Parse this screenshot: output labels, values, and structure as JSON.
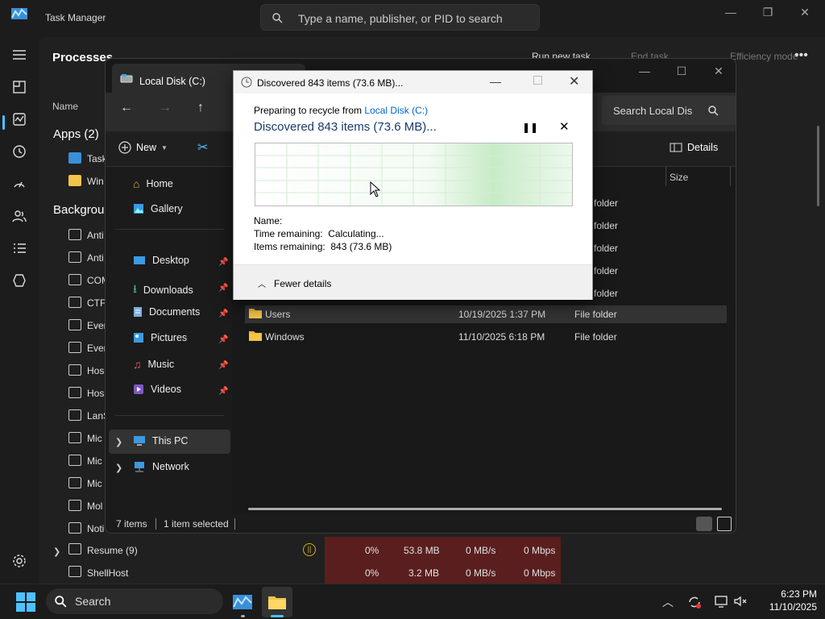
{
  "task_manager": {
    "title": "Task Manager",
    "search_placeholder": "Type a name, publisher, or PID to search",
    "section": "Processes",
    "run_new_task": "Run new task",
    "end_task": "End task",
    "efficiency_mode": "Efficiency mode",
    "col_name": "Name",
    "apps_header": "Apps (2)",
    "background_header": "Backgrou",
    "app_rows": [
      "Task",
      "Win"
    ],
    "bg_rows": [
      "Anti",
      "Anti",
      "COM",
      "CTF",
      "Ever",
      "Ever",
      "Hos",
      "Hos",
      "LanS",
      "Mic",
      "Mic",
      "Mic",
      "Mol",
      "Noti"
    ],
    "resume_row": {
      "name": "Resume (9)",
      "cpu": "0%",
      "mem": "53.8 MB",
      "disk": "0 MB/s",
      "net": "0 Mbps"
    },
    "shellhost_row": {
      "name": "ShellHost",
      "cpu": "0%",
      "mem": "3.2 MB",
      "disk": "0 MB/s",
      "net": "0 Mbps"
    }
  },
  "explorer": {
    "tab_title": "Local Disk (C:)",
    "search_placeholder": "Search Local Dis",
    "new_label": "New",
    "details_label": "Details",
    "col_size": "Size",
    "nav": {
      "home": "Home",
      "gallery": "Gallery",
      "desktop": "Desktop",
      "downloads": "Downloads",
      "documents": "Documents",
      "pictures": "Pictures",
      "music": "Music",
      "videos": "Videos",
      "this_pc": "This PC",
      "network": "Network"
    },
    "hidden_types": [
      "folder",
      "folder",
      "folder",
      "folder",
      "folder"
    ],
    "files": [
      {
        "name": "Users",
        "date": "10/19/2025 1:37 PM",
        "type": "File folder"
      },
      {
        "name": "Windows",
        "date": "11/10/2025 6:18 PM",
        "type": "File folder"
      }
    ],
    "status_items": "7 items",
    "status_selected": "1 item selected"
  },
  "dialog": {
    "title": "Discovered 843 items (73.6 MB)...",
    "preparing_prefix": "Preparing to recycle from ",
    "preparing_link": "Local Disk (C:)",
    "heading": "Discovered 843 items (73.6 MB)...",
    "name_label": "Name:",
    "time_label": "Time remaining:",
    "time_value": "Calculating...",
    "items_label": "Items remaining:",
    "items_value": "843 (73.6 MB)",
    "fewer_details": "Fewer details"
  },
  "taskbar": {
    "search": "Search",
    "time": "6:23 PM",
    "date": "11/10/2025"
  },
  "colors": {
    "accent": "#4cc2ff",
    "link": "#0066cc",
    "folder": "#f3c44a",
    "progress": "#c7ebc7"
  }
}
